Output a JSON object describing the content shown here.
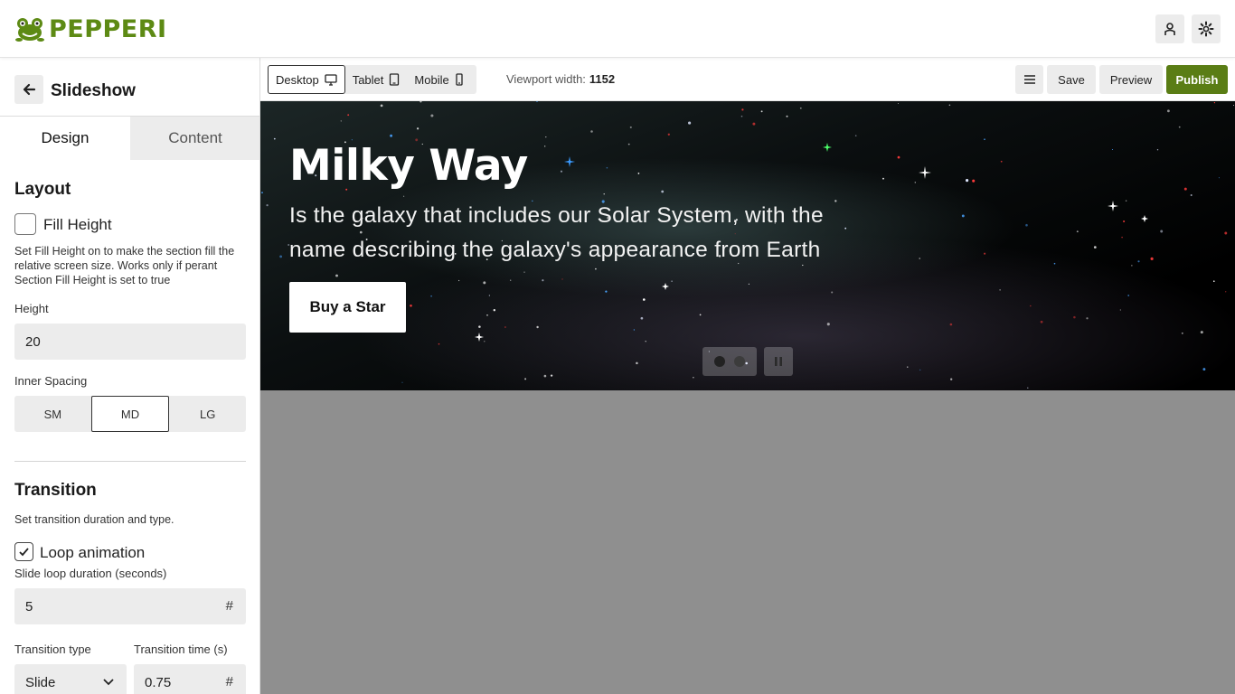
{
  "brand": {
    "name": "PEPPERI",
    "accent": "#5d8a14"
  },
  "header": {
    "icons": [
      "user-icon",
      "gear-icon"
    ]
  },
  "sidebar": {
    "title": "Slideshow",
    "tabs": [
      {
        "label": "Design"
      },
      {
        "label": "Content"
      }
    ],
    "layout": {
      "title": "Layout",
      "fill_height_label": "Fill Height",
      "fill_height_checked": false,
      "fill_height_help": "Set Fill Height on to make the section fill the relative screen size. Works only if perant Section Fill Height is set to true",
      "height_label": "Height",
      "height_value": "20",
      "inner_spacing_label": "Inner Spacing",
      "spacing_options": [
        "SM",
        "MD",
        "LG"
      ],
      "spacing_selected": "MD"
    },
    "transition": {
      "title": "Transition",
      "help": "Set transition duration and type.",
      "loop_label": "Loop animation",
      "loop_checked": true,
      "loop_duration_label": "Slide loop duration (seconds)",
      "loop_duration_value": "5",
      "type_label": "Transition type",
      "type_value": "Slide",
      "time_label": "Transition time (s)",
      "time_value": "0.75",
      "number_symbol": "#"
    }
  },
  "toolbar": {
    "devices": [
      {
        "label": "Desktop"
      },
      {
        "label": "Tablet"
      },
      {
        "label": "Mobile"
      }
    ],
    "active_device": "Desktop",
    "viewport_label": "Viewport width:",
    "viewport_value": "1152",
    "save_label": "Save",
    "preview_label": "Preview",
    "publish_label": "Publish",
    "publish_color": "#5a7d15"
  },
  "slide": {
    "title": "Milky Way",
    "subtitle": "Is the galaxy that includes our Solar System, with the name describing the galaxy's appearance from Earth",
    "button_label": "Buy a Star",
    "slide_count": 2,
    "active_slide": 1
  }
}
